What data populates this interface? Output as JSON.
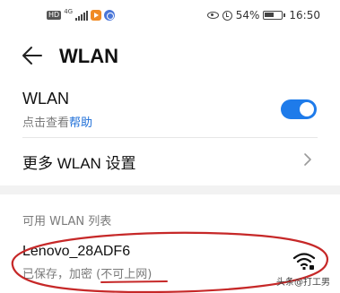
{
  "status_bar": {
    "hd_label": "HD",
    "network_label": "4G",
    "battery_percent": "54%",
    "time": "16:50",
    "icons": [
      "hd-icon",
      "signal-icon",
      "app-notification-icon",
      "browser-icon",
      "eye-comfort-icon",
      "alarm-icon",
      "battery-icon"
    ]
  },
  "header": {
    "title": "WLAN",
    "back_icon": "back-arrow-icon"
  },
  "wlan_row": {
    "label": "WLAN",
    "sub_prefix": "点击查看",
    "sub_link": "帮助",
    "toggle_on": true,
    "accent_color": "#1e7bea"
  },
  "more_row": {
    "label": "更多 WLAN 设置",
    "icon": "chevron-right-icon"
  },
  "available_section": {
    "header": "可用 WLAN 列表",
    "networks": [
      {
        "name": "Lenovo_28ADF6",
        "status": "已保存，加密 (不可上网)",
        "signal_icon": "wifi-signal-icon",
        "secured": true
      }
    ]
  },
  "annotation": {
    "color": "#c62828"
  },
  "watermark": "头条@打工男"
}
